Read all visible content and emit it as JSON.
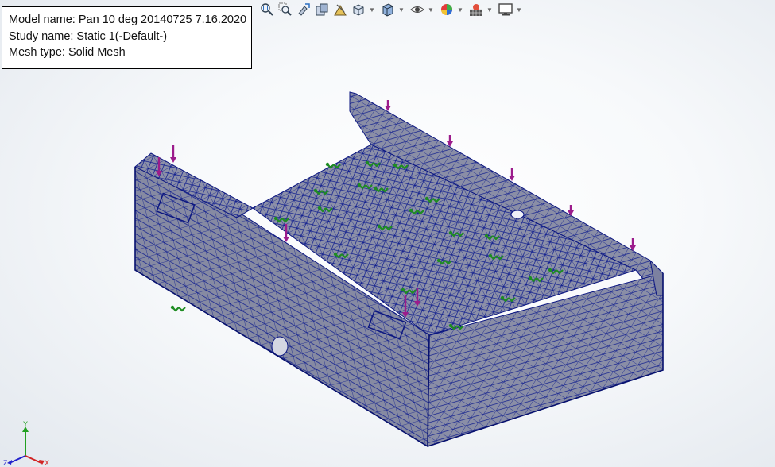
{
  "info": {
    "model_name": "Model name: Pan 10 deg 20140725 7.16.2020",
    "study_name": "Study name: Static 1(-Default-)",
    "mesh_type": "Mesh type: Solid Mesh"
  },
  "toolbar": [
    {
      "name": "zoom-to-fit-icon",
      "dropdown": false
    },
    {
      "name": "zoom-to-area-icon",
      "dropdown": false
    },
    {
      "name": "previous-view-icon",
      "dropdown": false
    },
    {
      "name": "section-view-icon",
      "dropdown": false
    },
    {
      "name": "dynamic-annotation-icon",
      "dropdown": false
    },
    {
      "name": "view-orientation-icon",
      "dropdown": true
    },
    {
      "name": "display-style-icon",
      "dropdown": true
    },
    {
      "name": "hide-show-items-icon",
      "dropdown": true
    },
    {
      "name": "edit-appearance-icon",
      "dropdown": true
    },
    {
      "name": "apply-scene-icon",
      "dropdown": true
    },
    {
      "name": "view-settings-icon",
      "dropdown": true
    }
  ],
  "triad": {
    "x_label": "X",
    "y_label": "Y",
    "z_label": "Z"
  },
  "colors": {
    "mesh_fill": "#8a8fa6",
    "mesh_lines": "#0c1a8c",
    "load_arrows": "#9c1c8c",
    "fixtures": "#1e8c22",
    "axis_x": "#d22222",
    "axis_y": "#22a022",
    "axis_z": "#2222cc"
  }
}
